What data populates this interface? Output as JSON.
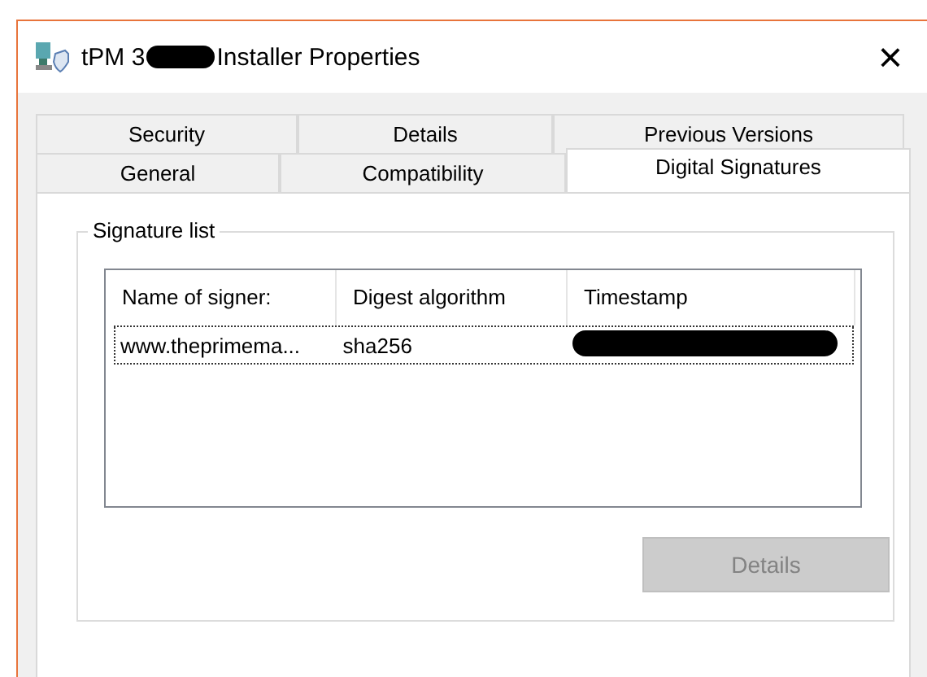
{
  "window": {
    "title_start": "tPM 3",
    "title_redacted": true,
    "title_end": "Installer Properties",
    "close": "×"
  },
  "tab_rows": [
    {
      "tabs": [
        {
          "label": "Security",
          "selected": false
        },
        {
          "label": "Details",
          "selected": false
        },
        {
          "label": "Previous Versions",
          "selected": false
        }
      ]
    },
    {
      "tabs": [
        {
          "label": "General",
          "selected": false
        },
        {
          "label": "Compatibility",
          "selected": false
        },
        {
          "label": "Digital Signatures",
          "selected": true
        }
      ]
    }
  ],
  "group": {
    "label": "Signature list"
  },
  "table": {
    "columns": [
      "Name of signer:",
      "Digest algorithm",
      "Timestamp"
    ],
    "rows": [
      {
        "name": "www.theprimema...",
        "digest": "sha256",
        "timestamp_redacted": true,
        "focused": true
      }
    ]
  },
  "details_button": {
    "label": "Details",
    "disabled": true
  }
}
